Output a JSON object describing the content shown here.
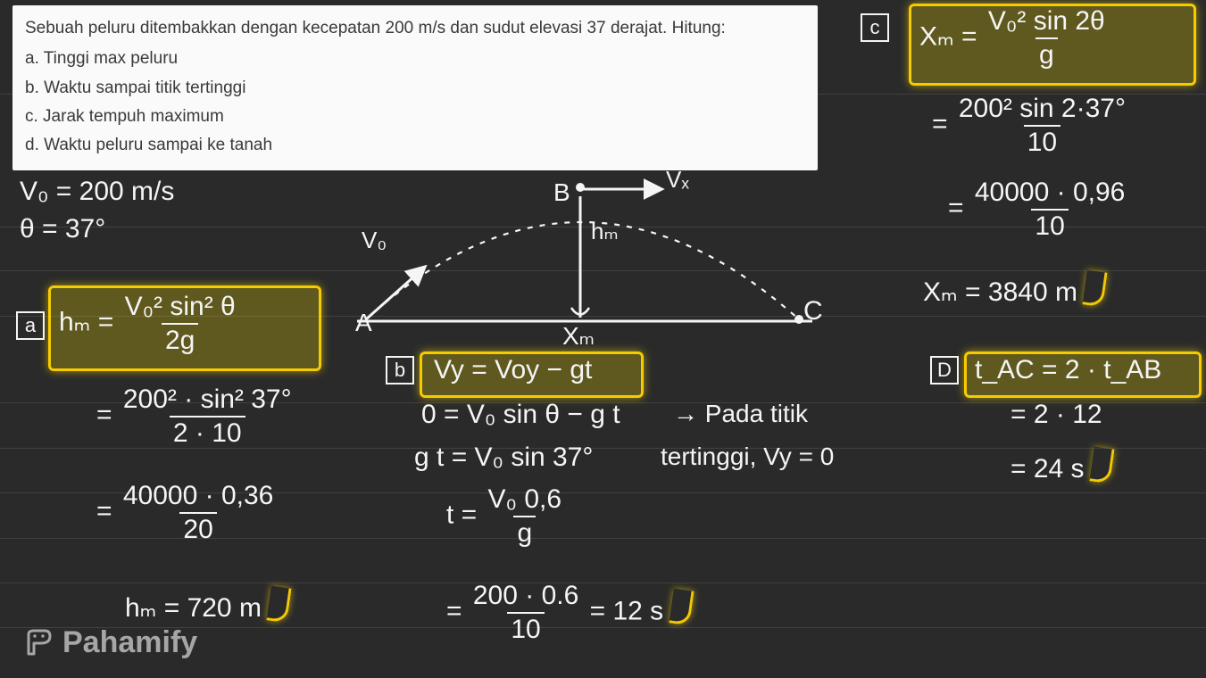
{
  "problem": {
    "prompt": "Sebuah peluru ditembakkan dengan kecepatan 200 m/s dan sudut elevasi 37 derajat. Hitung:",
    "a": "a. Tinggi max peluru",
    "b": "b. Waktu sampai titik tertinggi",
    "c": "c. Jarak tempuh maximum",
    "d": "d. Waktu peluru sampai ke tanah"
  },
  "given": {
    "v0": "V₀ = 200 m/s",
    "theta": "θ = 37°"
  },
  "labels": {
    "a": "a",
    "b": "b",
    "c": "c",
    "d": "D"
  },
  "partA": {
    "formula_lhs": "hₘ =",
    "formula_num": "V₀² sin² θ",
    "formula_den": "2g",
    "step1_num": "200² · sin² 37°",
    "step1_den": "2 · 10",
    "step2_num": "40000 · 0,36",
    "step2_den": "20",
    "result": "hₘ = 720 m"
  },
  "partB": {
    "formula": "Vy = Voy − gt",
    "line1": "0 = V₀ sin θ − g t",
    "line2": "g t = V₀ sin 37°",
    "line3_lhs": "t =",
    "line3_num": "V₀ 0,6",
    "line3_den": "g",
    "line4_num": "200 · 0.6",
    "line4_den": "10",
    "line4_rhs": "= 12 s",
    "note1": "→ Pada titik",
    "note2": "tertinggi, Vy = 0"
  },
  "partC": {
    "formula_lhs": "Xₘ =",
    "formula_num": "V₀² sin 2θ",
    "formula_den": "g",
    "step1_num": "200² sin 2·37°",
    "step1_den": "10",
    "step2_num": "40000 · 0,96",
    "step2_den": "10",
    "result": "Xₘ = 3840 m"
  },
  "partD": {
    "formula": "t_AC = 2 · t_AB",
    "step1": "= 2 · 12",
    "result": "= 24 s"
  },
  "diagram": {
    "A": "A",
    "B": "B",
    "C": "C",
    "V0": "V₀",
    "Vx": "Vₓ",
    "hm": "hₘ",
    "Xm": "Xₘ"
  },
  "logo": {
    "text": "Pahamify"
  }
}
